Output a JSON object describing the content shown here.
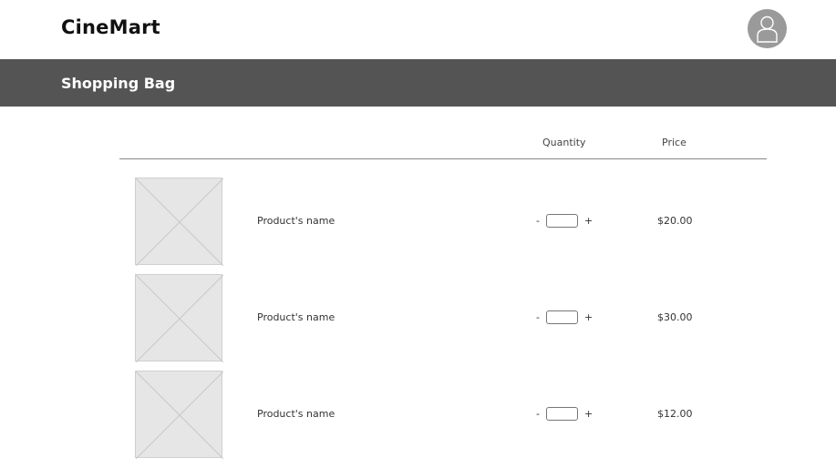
{
  "header": {
    "brand": "CineMart",
    "avatar_icon": "user-avatar-icon"
  },
  "titlebar": {
    "title": "Shopping Bag"
  },
  "table": {
    "columns": {
      "quantity": "Quantity",
      "price": "Price"
    },
    "items": [
      {
        "name": "Product's name",
        "decrement": "-",
        "increment": "+",
        "quantity": "",
        "price": "$20.00",
        "image_icon": "image-placeholder-icon"
      },
      {
        "name": "Product's name",
        "decrement": "-",
        "increment": "+",
        "quantity": "",
        "price": "$30.00",
        "image_icon": "image-placeholder-icon"
      },
      {
        "name": "Product's name",
        "decrement": "-",
        "increment": "+",
        "quantity": "",
        "price": "$12.00",
        "image_icon": "image-placeholder-icon"
      }
    ]
  },
  "colors": {
    "titlebar_bg": "#545454",
    "avatar_bg": "#9a9a9a",
    "placeholder_bg": "#e6e6e6"
  }
}
